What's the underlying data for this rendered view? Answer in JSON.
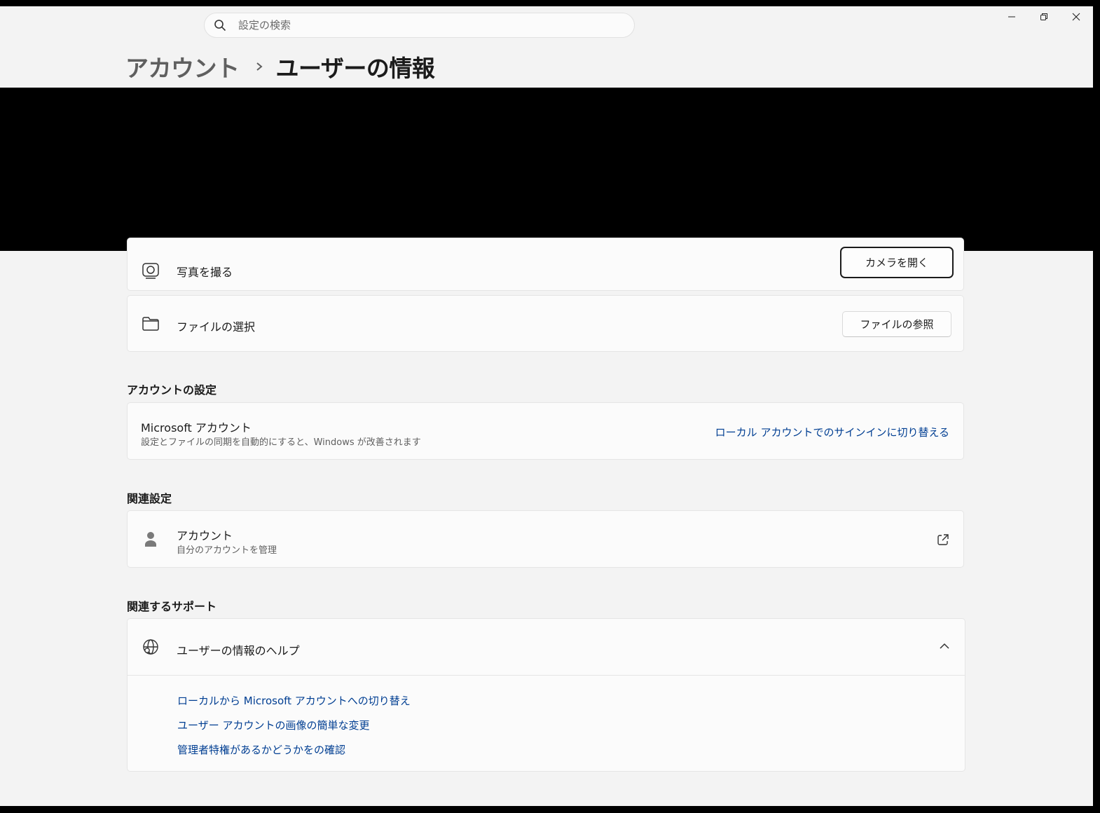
{
  "search": {
    "placeholder": "設定の検索"
  },
  "window_controls": {
    "minimize_icon": "minimize-icon",
    "restore_icon": "restore-icon",
    "close_icon": "close-icon"
  },
  "breadcrumb": {
    "parent": "アカウント",
    "separator": "›",
    "current": "ユーザーの情報"
  },
  "photo": {
    "take_photo_label": "写真を撮る",
    "open_camera_button": "カメラを開く",
    "choose_file_label": "ファイルの選択",
    "browse_files_button": "ファイルの参照"
  },
  "account_settings": {
    "section_title": "アカウントの設定",
    "title": "Microsoft アカウント",
    "subtitle": "設定とファイルの同期を自動的にすると、Windows が改善されます",
    "link": "ローカル アカウントでのサインインに切り替える"
  },
  "related_settings": {
    "section_title": "関連設定",
    "title": "アカウント",
    "subtitle": "自分のアカウントを管理"
  },
  "related_support": {
    "section_title": "関連するサポート",
    "help_title": "ユーザーの情報のヘルプ",
    "links": [
      "ローカルから Microsoft アカウントへの切り替え",
      "ユーザー アカウントの画像の簡単な変更",
      "管理者特権があるかどうかをの確認"
    ]
  },
  "colors": {
    "accent_link": "#003e92",
    "background": "#f3f3f3",
    "card": "#fbfbfb"
  }
}
